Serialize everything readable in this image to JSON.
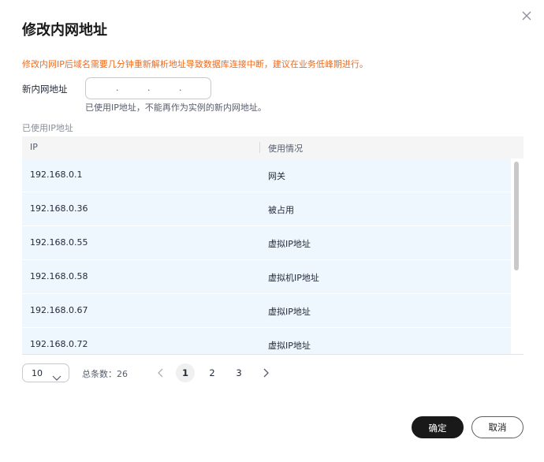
{
  "dialog": {
    "title": "修改内网地址",
    "warning": "修改内网IP后域名需要几分钟重新解析地址导致数据库连接中断，建议在业务低峰期进行。",
    "field_label": "新内网地址",
    "ip_input": {
      "value": "",
      "separator": "."
    },
    "hint": "已使用IP地址，不能再作为实例的新内网地址。",
    "section_label": "已使用IP地址"
  },
  "table": {
    "columns": [
      "IP",
      "使用情况"
    ],
    "rows": [
      {
        "ip": "192.168.0.1",
        "usage": "网关"
      },
      {
        "ip": "192.168.0.36",
        "usage": "被占用"
      },
      {
        "ip": "192.168.0.55",
        "usage": "虚拟IP地址"
      },
      {
        "ip": "192.168.0.58",
        "usage": "虚拟机IP地址"
      },
      {
        "ip": "192.168.0.67",
        "usage": "虚拟IP地址"
      },
      {
        "ip": "192.168.0.72",
        "usage": "虚拟IP地址"
      }
    ]
  },
  "pagination": {
    "page_size": "10",
    "total_label": "总条数：26",
    "pages": [
      "1",
      "2",
      "3"
    ],
    "current_page": "1"
  },
  "footer": {
    "ok_label": "确定",
    "cancel_label": "取消"
  },
  "colors": {
    "warning": "#ed6b1d",
    "row_background": "#eef6fe",
    "primary_button": "#191919"
  }
}
